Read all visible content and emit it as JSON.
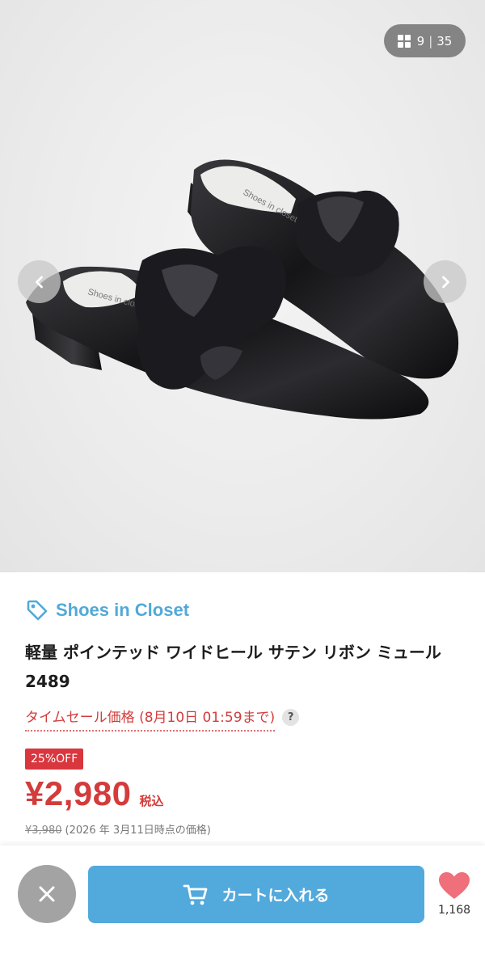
{
  "gallery": {
    "current": "9",
    "separator": "|",
    "total": "35",
    "image_text": {
      "insole_brand_back": "Shoes in closet",
      "insole_brand_front": "Shoes in closet"
    }
  },
  "product": {
    "shop_name": "Shoes in Closet",
    "title": "軽量 ポインテッド ワイドヒール サテン リボン ミュール 2489",
    "sale_label": "タイムセール価格 (8月10日 01:59まで)",
    "help_symbol": "?",
    "discount_badge": "25%OFF",
    "price": "¥2,980",
    "tax_label": "税込",
    "original_price": "¥3,980",
    "original_price_note": "(2026 年 3月11日時点の価格)"
  },
  "actions": {
    "cart_label": "カートに入れる",
    "favorite_count": "1,168"
  },
  "icons": {
    "grid": "grid-icon",
    "prev": "chevron-left-icon",
    "next": "chevron-right-icon",
    "tag": "tag-icon",
    "close": "close-icon",
    "cart": "cart-icon",
    "heart": "heart-icon"
  },
  "colors": {
    "accent_blue": "#52a9dc",
    "sale_red": "#d43b3b",
    "heart_pink": "#ef6f7a"
  }
}
